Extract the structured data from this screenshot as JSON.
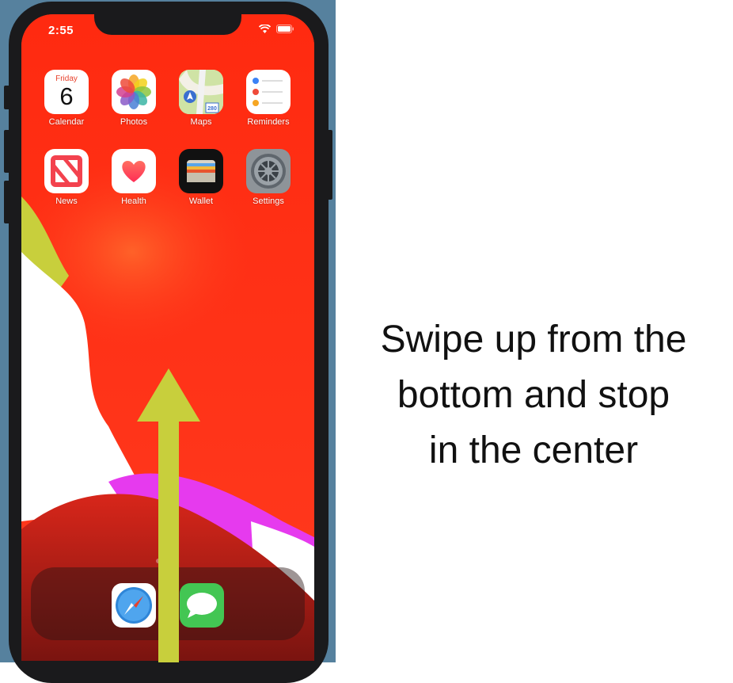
{
  "status_bar": {
    "time": "2:55"
  },
  "apps": [
    {
      "label": "Calendar",
      "icon": "calendar-icon",
      "weekday": "Friday",
      "day": "6"
    },
    {
      "label": "Photos",
      "icon": "photos-icon"
    },
    {
      "label": "Maps",
      "icon": "maps-icon",
      "route_badge": "280"
    },
    {
      "label": "Reminders",
      "icon": "reminders-icon"
    },
    {
      "label": "News",
      "icon": "news-icon"
    },
    {
      "label": "Health",
      "icon": "health-icon"
    },
    {
      "label": "Wallet",
      "icon": "wallet-icon"
    },
    {
      "label": "Settings",
      "icon": "settings-icon"
    }
  ],
  "dock": [
    {
      "icon": "safari-icon"
    },
    {
      "icon": "messages-icon"
    }
  ],
  "instruction": {
    "lines": [
      "Swipe up from the",
      "bottom and stop",
      "in the center"
    ]
  },
  "colors": {
    "frame_background": "#56819e",
    "wallpaper_red": "#ff2e12",
    "arrow": "#c8cf3c",
    "magenta": "#e63aee"
  }
}
